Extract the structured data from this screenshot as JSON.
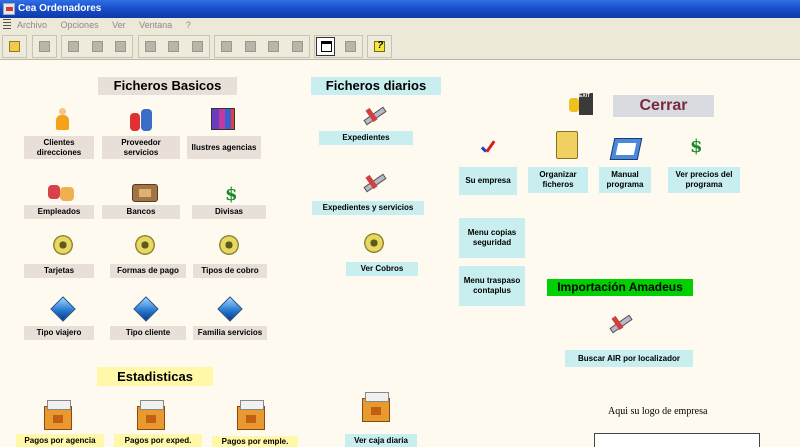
{
  "window": {
    "title": "Cea Ordenadores"
  },
  "menu": [
    "Archivo",
    "Opciones",
    "Ver",
    "Ventana",
    "?"
  ],
  "sections": {
    "ficheros_basicos": "Ficheros Basicos",
    "ficheros_diarios": "Ficheros diarios",
    "estadisticas": "Estadisticas",
    "importacion": "Importación Amadeus"
  },
  "basicos": {
    "clientes": "Clientes direcciones",
    "proveedor": "Proveedor servicios",
    "ilustres": "Ilustres agencias",
    "empleados": "Empleados",
    "bancos": "Bancos",
    "divisas": "Divisas",
    "tarjetas": "Tarjetas",
    "formas_pago": "Formas de pago",
    "tipos_cobro": "Tipos de cobro",
    "tipo_viajero": "Tipo viajero",
    "tipo_cliente": "Tipo cliente",
    "familia_servicios": "Familia servicios"
  },
  "diarios": {
    "expedientes": "Expedientes",
    "expedientes_servicios": "Expedientes y servicios",
    "ver_cobros": "Ver Cobros"
  },
  "estadisticas_items": {
    "pagos_agencia": "Pagos por agencia",
    "pagos_exped": "Pagos por exped.",
    "pagos_emple": "Pagos por emple.",
    "ver_caja": "Ver caja diaria"
  },
  "right": {
    "cerrar": "Cerrar",
    "exit_sign": "EXIT",
    "su_empresa": "Su empresa",
    "organizar": "Organizar ficheros",
    "manual": "Manual programa",
    "ver_precios": "Ver precios del programa",
    "copias": "Menu copias seguridad",
    "traspaso": "Menu traspaso contaplus",
    "buscar_air": "Buscar AIR por localizador",
    "logo_caption": "Aqui su logo de empresa"
  }
}
